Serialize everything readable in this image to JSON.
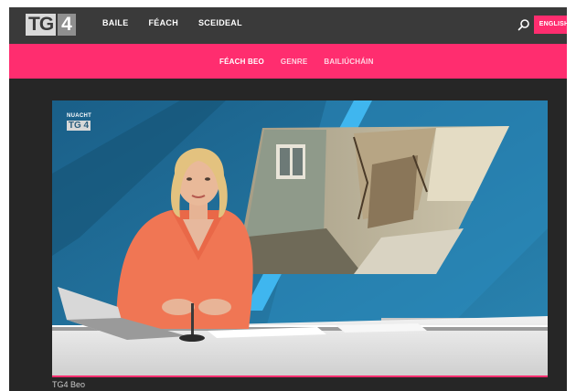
{
  "logo": {
    "part1": "TG",
    "part2": "4"
  },
  "topnav": {
    "items": [
      "BAILE",
      "FÉACH",
      "SCEIDEAL"
    ],
    "language_button": "ENGLISH",
    "search_icon": "search-icon"
  },
  "subnav": {
    "items": [
      "FÉACH BEO",
      "GENRE",
      "BAILIÚCHÁIN"
    ],
    "active": "FÉACH BEO"
  },
  "video": {
    "channel_bug_line1": "NUACHT",
    "channel_bug_line2": "TG 4"
  },
  "caption": "TG4 Beo",
  "colors": {
    "accent": "#ff2d6f",
    "nav_bg": "#3a3a3a",
    "page_bg": "#262626"
  }
}
